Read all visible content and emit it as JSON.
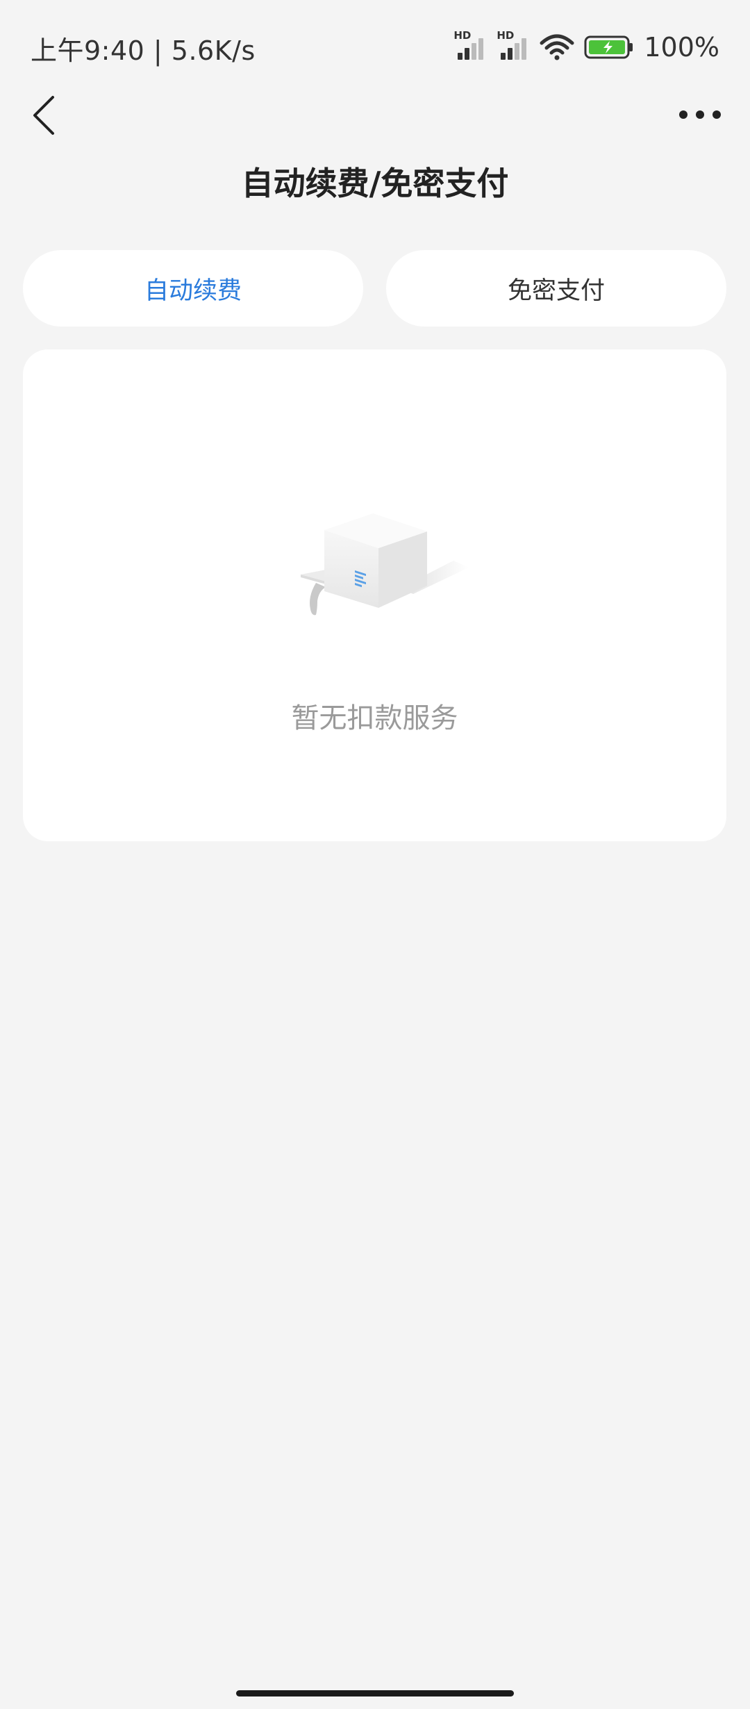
{
  "status_bar": {
    "time_speed": "上午9:40 | 5.6K/s",
    "signal_1_label": "HD",
    "signal_2_label": "HD",
    "battery_percent": "100%"
  },
  "header": {
    "title": "自动续费/免密支付"
  },
  "tabs": [
    {
      "label": "自动续费",
      "active": true
    },
    {
      "label": "免密支付",
      "active": false
    }
  ],
  "empty_state": {
    "message": "暂无扣款服务"
  },
  "colors": {
    "accent": "#2a7bdc",
    "background": "#f4f4f4",
    "card": "#ffffff",
    "battery_fill": "#4cc23a"
  }
}
